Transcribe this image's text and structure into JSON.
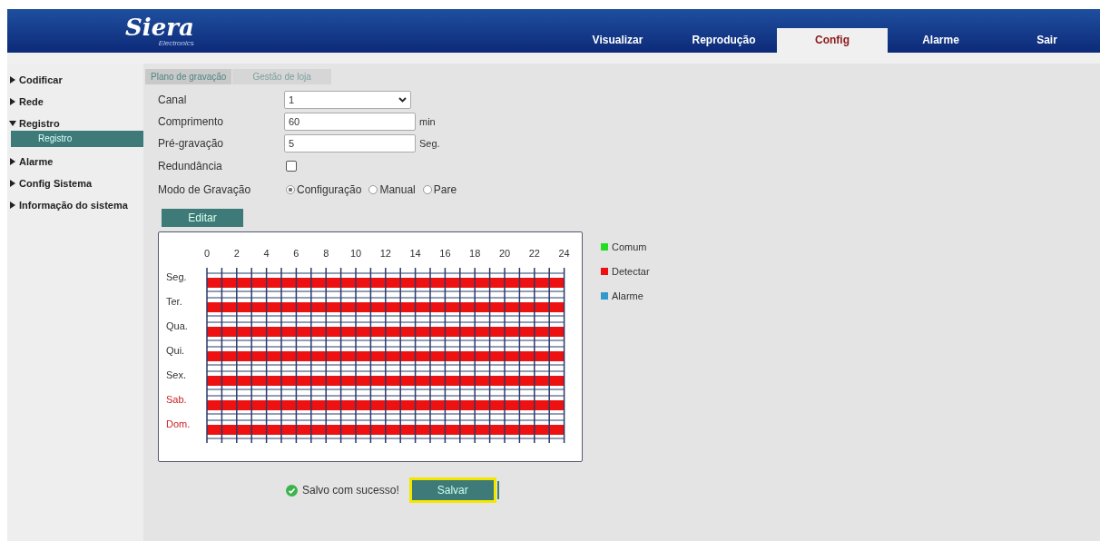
{
  "header": {
    "logo": "Siera",
    "logo_sub": "Electronics",
    "tabs": [
      {
        "label": "Visualizar",
        "selected": false
      },
      {
        "label": "Reprodução",
        "selected": false
      },
      {
        "label": "Config",
        "selected": true
      },
      {
        "label": "Alarme",
        "selected": false
      },
      {
        "label": "Sair",
        "selected": false
      }
    ]
  },
  "sidebar": {
    "items": [
      {
        "label": "Codificar",
        "expanded": false
      },
      {
        "label": "Rede",
        "expanded": false
      },
      {
        "label": "Registro",
        "expanded": true,
        "children": [
          {
            "label": "Registro",
            "selected": true
          }
        ]
      },
      {
        "label": "Alarme",
        "expanded": false
      },
      {
        "label": "Config Sistema",
        "expanded": false
      },
      {
        "label": "Informação do sistema",
        "expanded": false
      }
    ]
  },
  "subtabs": [
    {
      "label": "Plano de gravação",
      "selected": true
    },
    {
      "label": "Gestão de loja",
      "selected": false
    }
  ],
  "form": [
    {
      "kind": "select",
      "label": "Canal",
      "value": "1"
    },
    {
      "kind": "text",
      "label": "Comprimento",
      "value": "60",
      "unit": "min"
    },
    {
      "kind": "text",
      "label": "Pré-gravação",
      "value": "5",
      "unit": "Seg."
    },
    {
      "kind": "checkbox",
      "label": "Redundância",
      "checked": false
    },
    {
      "kind": "radio",
      "label": "Modo de Gravação",
      "options": [
        {
          "label": "Configuração",
          "selected": true
        },
        {
          "label": "Manual",
          "selected": false
        },
        {
          "label": "Pare",
          "selected": false
        }
      ]
    }
  ],
  "edit_button": "Editar",
  "schedule": {
    "hours": [
      "0",
      "2",
      "4",
      "6",
      "8",
      "10",
      "12",
      "14",
      "16",
      "18",
      "20",
      "22",
      "24"
    ],
    "days": [
      {
        "label": "Seg.",
        "weekend": false,
        "kind": "detect"
      },
      {
        "label": "Ter.",
        "weekend": false,
        "kind": "detect"
      },
      {
        "label": "Qua.",
        "weekend": false,
        "kind": "detect"
      },
      {
        "label": "Qui.",
        "weekend": false,
        "kind": "detect"
      },
      {
        "label": "Sex.",
        "weekend": false,
        "kind": "detect"
      },
      {
        "label": "Sab.",
        "weekend": true,
        "kind": "detect"
      },
      {
        "label": "Dom.",
        "weekend": true,
        "kind": "detect"
      }
    ]
  },
  "legend": [
    {
      "kind": "common",
      "label": "Comum",
      "color": "#22dd22"
    },
    {
      "kind": "detect",
      "label": "Detectar",
      "color": "#ee1111"
    },
    {
      "kind": "alarm",
      "label": "Alarme",
      "color": "#3399cc"
    }
  ],
  "status": {
    "message": "Salvo com sucesso!",
    "success": true
  },
  "save_button": {
    "label": "Salvar",
    "highlighted": true
  }
}
